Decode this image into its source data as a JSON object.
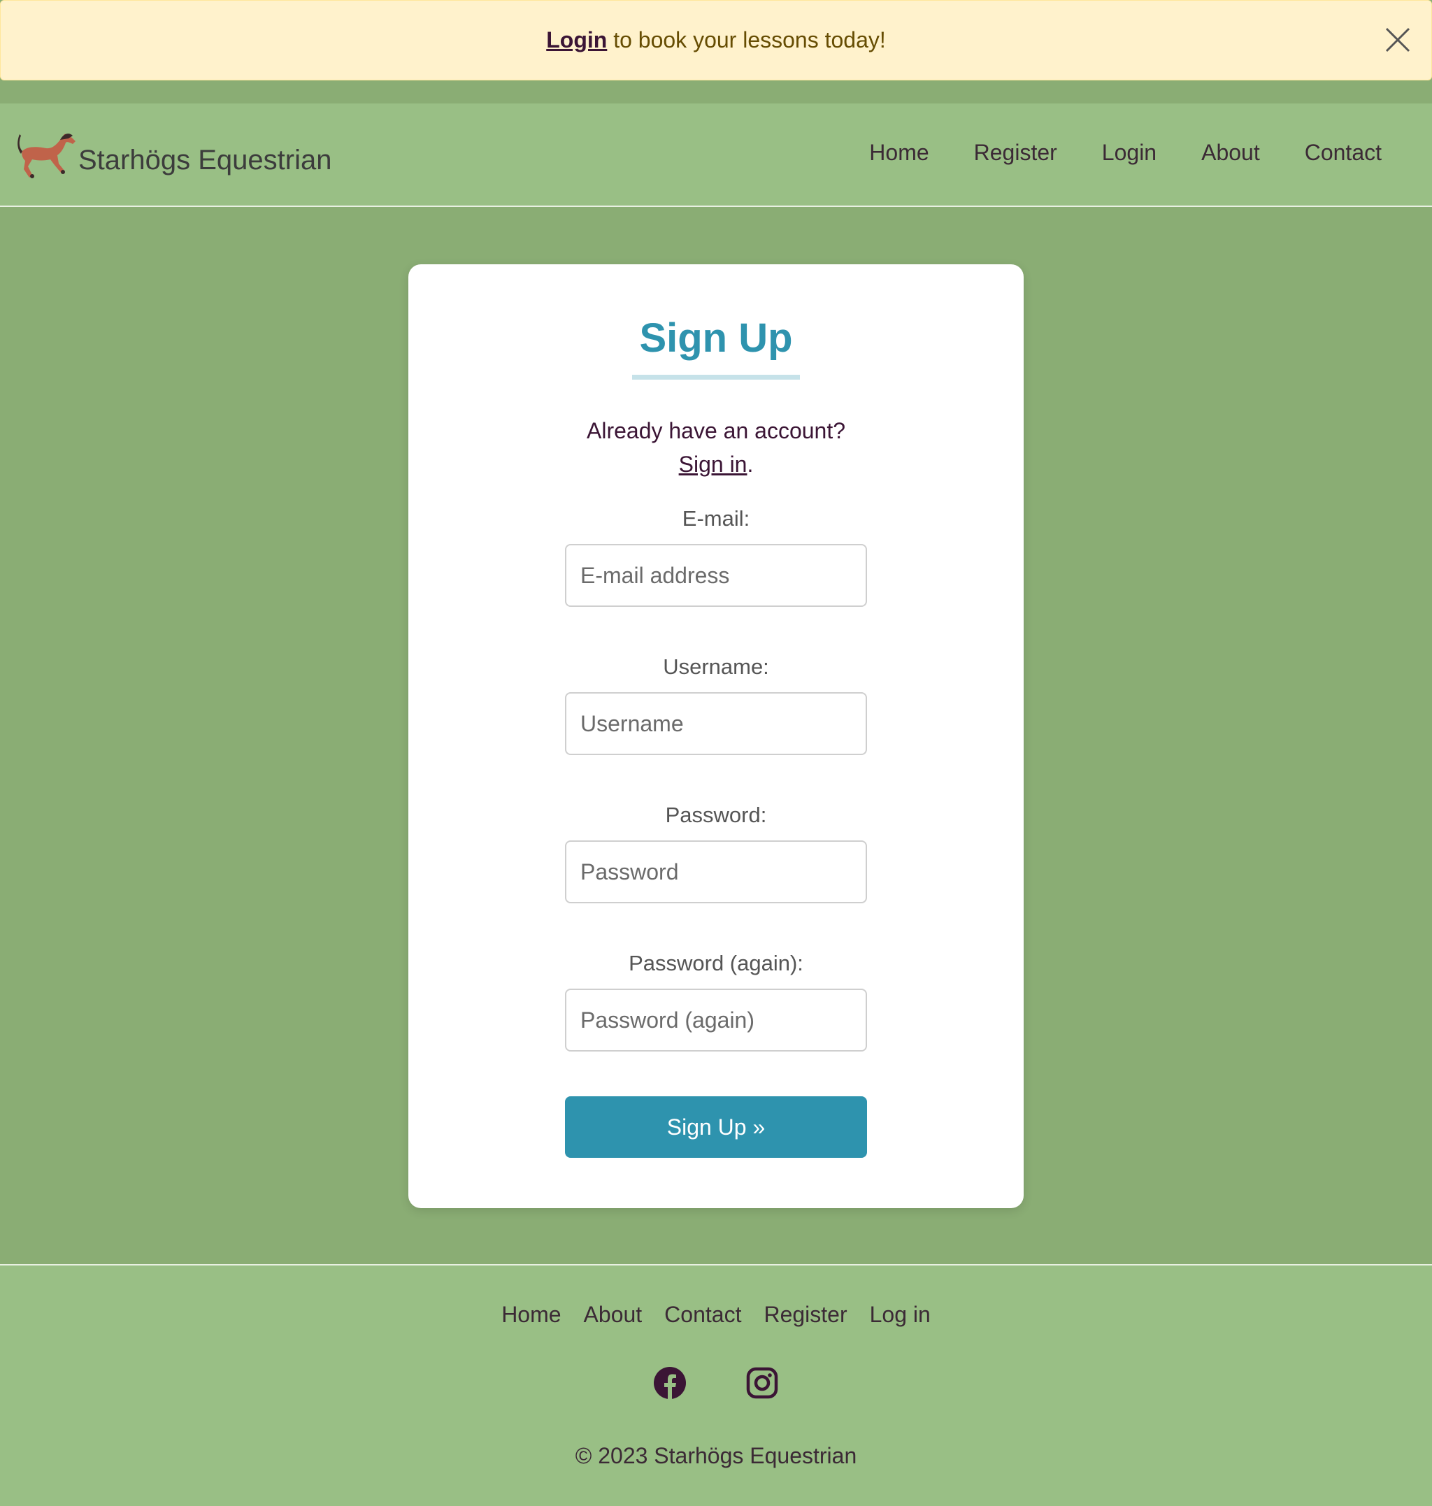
{
  "alert": {
    "link_label": "Login",
    "message": " to book your lessons today!",
    "close_icon": "close-icon"
  },
  "navbar": {
    "brand_name": "Starhögs Equestrian",
    "logo_icon": "horse-icon",
    "links": [
      "Home",
      "Register",
      "Login",
      "About",
      "Contact"
    ]
  },
  "signup": {
    "title": "Sign Up",
    "already_text": "Already have an account?",
    "signin_link": "Sign in",
    "signin_suffix": ".",
    "fields": [
      {
        "label": "E-mail:",
        "placeholder": "E-mail address"
      },
      {
        "label": "Username:",
        "placeholder": "Username"
      },
      {
        "label": "Password:",
        "placeholder": "Password"
      },
      {
        "label": "Password (again):",
        "placeholder": "Password (again)"
      }
    ],
    "submit_label": "Sign Up »"
  },
  "footer": {
    "links": [
      "Home",
      "About",
      "Contact",
      "Register",
      "Log in"
    ],
    "social_icons": [
      "facebook-icon",
      "instagram-icon"
    ],
    "copyright": "© 2023 Starhögs Equestrian"
  },
  "colors": {
    "page_bg": "#8aad74",
    "nav_bg": "#99bf85",
    "alert_bg": "#fff2cc",
    "accent": "#2e93ae",
    "text_dark": "#3b1535"
  }
}
